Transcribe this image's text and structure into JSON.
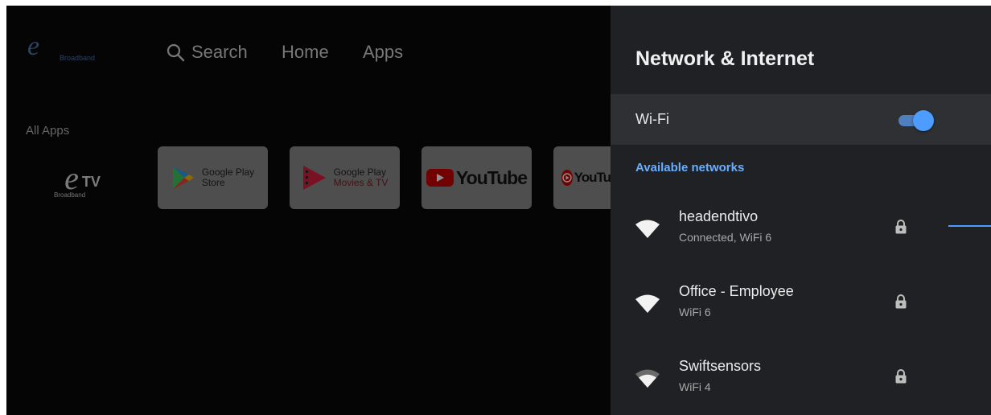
{
  "home": {
    "logo_text": "Broadband",
    "nav": {
      "search_label": "Search",
      "home_label": "Home",
      "apps_label": "Apps"
    },
    "section_label": "All Apps",
    "apps": {
      "etv": {
        "mark": "e",
        "tv": "TV",
        "small": "Broadband"
      },
      "google_play_store": {
        "line1": "Google Play",
        "line2": "Store"
      },
      "google_play_movies": {
        "line1": "Google Play",
        "line2": "Movies & TV"
      },
      "youtube": {
        "word": "YouTube"
      },
      "youtube_music": {
        "word": "YouTu"
      }
    }
  },
  "panel": {
    "title": "Network & Internet",
    "wifi": {
      "label": "Wi-Fi",
      "enabled": true
    },
    "available_label": "Available networks",
    "networks": [
      {
        "name": "headendtivo",
        "status": "Connected, WiFi 6",
        "signal": "full",
        "secured": true
      },
      {
        "name": "Office - Employee",
        "status": "WiFi 6",
        "signal": "full",
        "secured": true
      },
      {
        "name": "Swiftsensors",
        "status": "WiFi 4",
        "signal": "partial",
        "secured": true
      }
    ]
  },
  "colors": {
    "accent": "#4d9cff",
    "panel_bg": "#202124",
    "row_highlight": "#2f3034"
  }
}
